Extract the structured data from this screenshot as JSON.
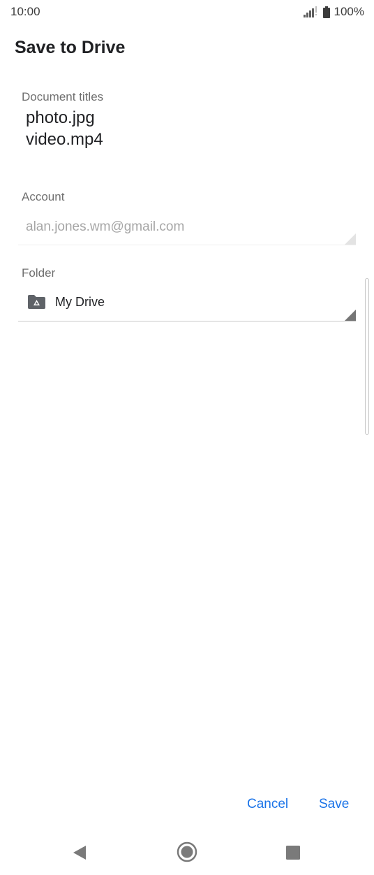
{
  "status_bar": {
    "time": "10:00",
    "battery": "100%",
    "icons": [
      "signal-icon",
      "battery-icon"
    ]
  },
  "dialog": {
    "title": "Save to Drive",
    "document_titles": {
      "label": "Document titles",
      "items": [
        "photo.jpg",
        "video.mp4"
      ]
    },
    "account": {
      "label": "Account",
      "value": "alan.jones.wm@gmail.com"
    },
    "folder": {
      "label": "Folder",
      "value": "My Drive",
      "icon": "drive-folder-icon"
    },
    "buttons": {
      "cancel": "Cancel",
      "save": "Save"
    }
  },
  "navigation": {
    "icons": [
      "back-icon",
      "home-icon",
      "recents-icon"
    ]
  },
  "colors": {
    "accent": "#1a73e8",
    "text_primary": "#202124",
    "text_secondary": "#6f6f6f",
    "text_disabled": "#a6a6a6"
  }
}
